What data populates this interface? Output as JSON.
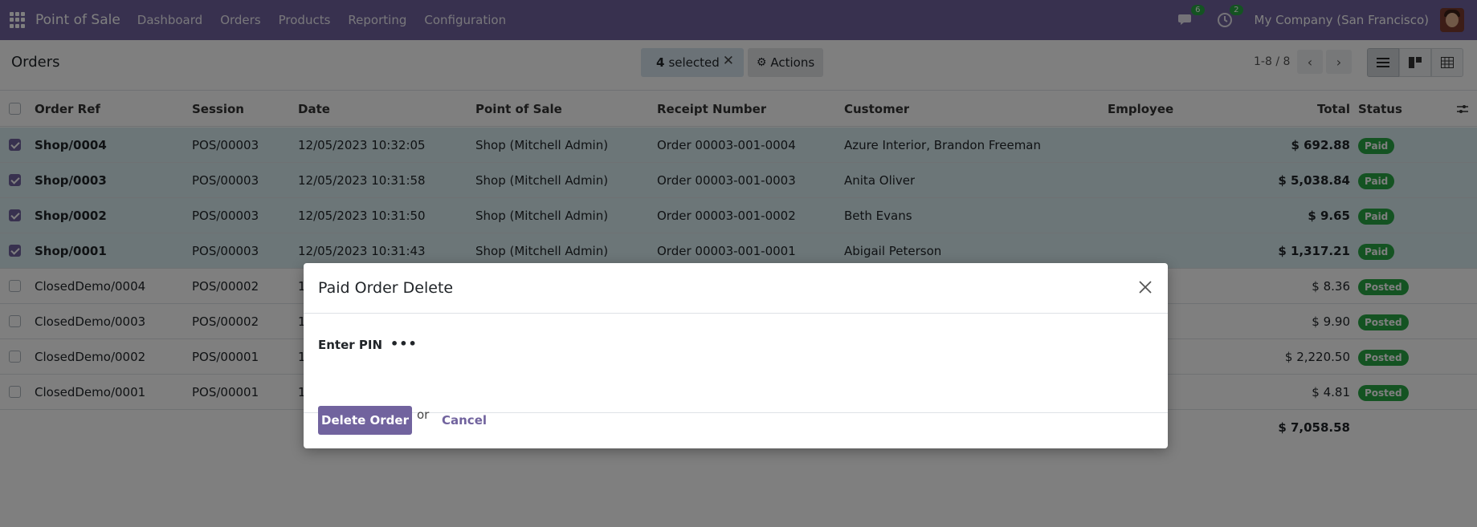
{
  "navbar": {
    "brand": "Point of Sale",
    "menu": [
      "Dashboard",
      "Orders",
      "Products",
      "Reporting",
      "Configuration"
    ],
    "messages_count": "6",
    "activities_count": "2",
    "company": "My Company (San Francisco)"
  },
  "control": {
    "breadcrumb": "Orders",
    "selected_count": "4",
    "selected_label": "selected",
    "actions_label": "Actions",
    "pager": "1-8 / 8"
  },
  "table": {
    "columns": [
      "Order Ref",
      "Session",
      "Date",
      "Point of Sale",
      "Receipt Number",
      "Customer",
      "Employee",
      "Total",
      "Status"
    ],
    "rows": [
      {
        "ref": "Shop/0004",
        "session": "POS/00003",
        "date": "12/05/2023 10:32:05",
        "pos": "Shop (Mitchell Admin)",
        "receipt": "Order 00003-001-0004",
        "customer": "Azure Interior, Brandon Freeman",
        "employee": "",
        "total": "$ 692.88",
        "status": "Paid",
        "checked": true
      },
      {
        "ref": "Shop/0003",
        "session": "POS/00003",
        "date": "12/05/2023 10:31:58",
        "pos": "Shop (Mitchell Admin)",
        "receipt": "Order 00003-001-0003",
        "customer": "Anita Oliver",
        "employee": "",
        "total": "$ 5,038.84",
        "status": "Paid",
        "checked": true
      },
      {
        "ref": "Shop/0002",
        "session": "POS/00003",
        "date": "12/05/2023 10:31:50",
        "pos": "Shop (Mitchell Admin)",
        "receipt": "Order 00003-001-0002",
        "customer": "Beth Evans",
        "employee": "",
        "total": "$ 9.65",
        "status": "Paid",
        "checked": true
      },
      {
        "ref": "Shop/0001",
        "session": "POS/00003",
        "date": "12/05/2023 10:31:43",
        "pos": "Shop (Mitchell Admin)",
        "receipt": "Order 00003-001-0001",
        "customer": "Abigail Peterson",
        "employee": "",
        "total": "$ 1,317.21",
        "status": "Paid",
        "checked": true
      },
      {
        "ref": "ClosedDemo/0004",
        "session": "POS/00002",
        "date": "1",
        "pos": "",
        "receipt": "",
        "customer": "",
        "employee": "",
        "total": "$ 8.36",
        "status": "Posted",
        "checked": false
      },
      {
        "ref": "ClosedDemo/0003",
        "session": "POS/00002",
        "date": "1",
        "pos": "",
        "receipt": "",
        "customer": "",
        "employee": "",
        "total": "$ 9.90",
        "status": "Posted",
        "checked": false
      },
      {
        "ref": "ClosedDemo/0002",
        "session": "POS/00001",
        "date": "1",
        "pos": "",
        "receipt": "",
        "customer": "",
        "employee": "",
        "total": "$ 2,220.50",
        "status": "Posted",
        "checked": false
      },
      {
        "ref": "ClosedDemo/0001",
        "session": "POS/00001",
        "date": "1",
        "pos": "",
        "receipt": "",
        "customer": "",
        "employee": "",
        "total": "$ 4.81",
        "status": "Posted",
        "checked": false
      }
    ],
    "grand_total": "$ 7,058.58"
  },
  "modal": {
    "title": "Paid Order Delete",
    "pin_label": "Enter PIN",
    "pin_value": "•••",
    "delete_label": "Delete Order",
    "or_text": "or",
    "cancel_label": "Cancel"
  },
  "colors": {
    "brand": "#71639e",
    "paid": "#28a745",
    "selected_row": "#d8ecf1"
  }
}
